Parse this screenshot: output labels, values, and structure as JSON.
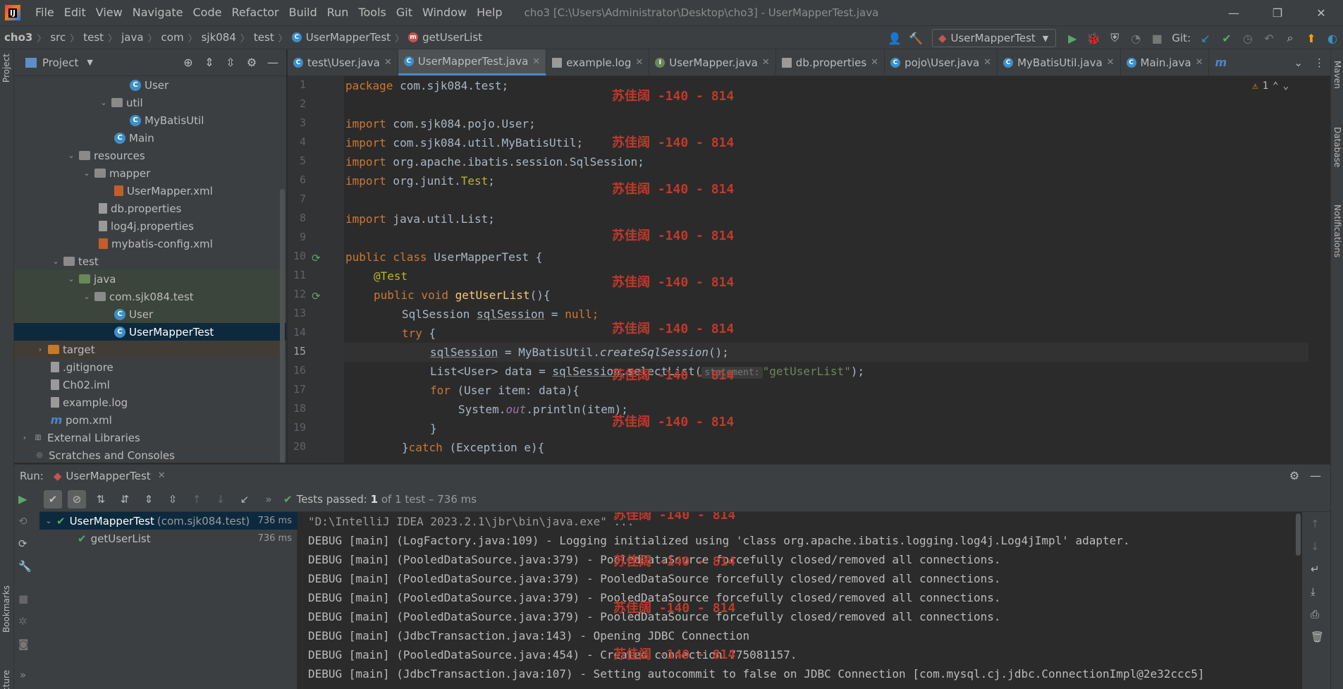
{
  "window": {
    "logo": "IJ",
    "title": "cho3 [C:\\Users\\Administrator\\Desktop\\cho3] - UserMapperTest.java",
    "menu": [
      "File",
      "Edit",
      "View",
      "Navigate",
      "Code",
      "Refactor",
      "Build",
      "Run",
      "Tools",
      "Git",
      "Window",
      "Help"
    ]
  },
  "breadcrumbs": [
    "cho3",
    "src",
    "test",
    "java",
    "com",
    "sjk084",
    "test",
    "UserMapperTest",
    "getUserList"
  ],
  "toolbar": {
    "run_config": "UserMapperTest",
    "git_label": "Git:"
  },
  "project_panel": {
    "title": "Project",
    "tree": [
      {
        "label": "User",
        "icon": "class"
      },
      {
        "label": "util",
        "icon": "folder"
      },
      {
        "label": "MyBatisUtil",
        "icon": "class"
      },
      {
        "label": "Main",
        "icon": "class"
      },
      {
        "label": "resources",
        "icon": "folder"
      },
      {
        "label": "mapper",
        "icon": "folder"
      },
      {
        "label": "UserMapper.xml",
        "icon": "xml"
      },
      {
        "label": "db.properties",
        "icon": "properties"
      },
      {
        "label": "log4j.properties",
        "icon": "properties"
      },
      {
        "label": "mybatis-config.xml",
        "icon": "xml"
      },
      {
        "label": "test",
        "icon": "folder"
      },
      {
        "label": "java",
        "icon": "folder"
      },
      {
        "label": "com.sjk084.test",
        "icon": "package"
      },
      {
        "label": "User",
        "icon": "class"
      },
      {
        "label": "UserMapperTest",
        "icon": "class"
      },
      {
        "label": "target",
        "icon": "folder"
      },
      {
        "label": ".gitignore",
        "icon": "file"
      },
      {
        "label": "Ch02.iml",
        "icon": "file"
      },
      {
        "label": "example.log",
        "icon": "file"
      },
      {
        "label": "pom.xml",
        "icon": "maven"
      },
      {
        "label": "External Libraries",
        "icon": "library"
      },
      {
        "label": "Scratches and Consoles",
        "icon": "scratch"
      }
    ]
  },
  "editor": {
    "tabs": [
      "test\\User.java",
      "UserMapperTest.java",
      "example.log",
      "UserMapper.java",
      "db.properties",
      "pojo\\User.java",
      "MyBatisUtil.java",
      "Main.java"
    ],
    "active_tab": "UserMapperTest.java",
    "warning_count": "1",
    "line_numbers": [
      "1",
      "2",
      "3",
      "4",
      "5",
      "6",
      "7",
      "8",
      "9",
      "10",
      "11",
      "12",
      "13",
      "14",
      "15",
      "16",
      "17",
      "18",
      "19",
      "20"
    ],
    "current_line": "15",
    "code": {
      "l1_kw": "package",
      "l1_rest": " com.sjk084.test;",
      "l3_kw": "import",
      "l3_rest": " com.sjk084.pojo.User;",
      "l4_kw": "import",
      "l4_rest": " com.sjk084.util.MyBatisUtil;",
      "l5_kw": "import",
      "l5_rest": " org.apache.ibatis.session.SqlSession;",
      "l6_kw": "import",
      "l6_rest": " org.junit.",
      "l6_ann": "Test",
      "l6_end": ";",
      "l8_kw": "import",
      "l8_rest": " java.util.List;",
      "l10_kw": "public class",
      "l10_rest": " UserMapperTest {",
      "l11_ann": "@Test",
      "l12_kw": "public void",
      "l12_fn": "getUserList",
      "l12_rest": "(){",
      "l13_a": "SqlSession ",
      "l13_var": "sqlSession",
      "l13_b": " = ",
      "l13_kw": "null",
      "l13_end": ";",
      "l14_kw": "try",
      "l14_rest": " {",
      "l15_var": "sqlSession",
      "l15_a": " = MyBatisUtil.",
      "l15_m": "createSqlSession",
      "l15_end": "();",
      "l16_a": "List<User> data = ",
      "l16_var": "sqlSession",
      "l16_b": ".selectList(",
      "l16_hint": "statement:",
      "l16_str": "\"getUserList\"",
      "l16_end": ");",
      "l17_kw": "for",
      "l17_rest": " (User item: data){",
      "l18_a": "System.",
      "l18_fld": "out",
      "l18_rest": ".println(item);",
      "l19": "}",
      "l20_a": "}",
      "l20_kw": "catch",
      "l20_rest": " (Exception e){"
    }
  },
  "watermark": "苏佳阔 -140 - 814",
  "run_panel": {
    "label": "Run:",
    "tab": "UserMapperTest",
    "status_prefix": "Tests passed:",
    "status_count": "1",
    "status_suffix": "of 1 test – 736 ms",
    "tests": [
      {
        "name": "UserMapperTest",
        "pkg": "(com.sjk084.test)",
        "time": "736 ms"
      },
      {
        "name": "getUserList",
        "pkg": "",
        "time": "736 ms"
      }
    ],
    "console": [
      "\"D:\\IntelliJ IDEA 2023.2.1\\jbr\\bin\\java.exe\" ...",
      "DEBUG [main] (LogFactory.java:109) - Logging initialized using 'class org.apache.ibatis.logging.log4j.Log4jImpl' adapter.",
      "DEBUG [main] (PooledDataSource.java:379) - PooledDataSource forcefully closed/removed all connections.",
      "DEBUG [main] (PooledDataSource.java:379) - PooledDataSource forcefully closed/removed all connections.",
      "DEBUG [main] (PooledDataSource.java:379) - PooledDataSource forcefully closed/removed all connections.",
      "DEBUG [main] (PooledDataSource.java:379) - PooledDataSource forcefully closed/removed all connections.",
      "DEBUG [main] (JdbcTransaction.java:143) - Opening JDBC Connection",
      "DEBUG [main] (PooledDataSource.java:454) - Created connection 775081157.",
      "DEBUG [main] (JdbcTransaction.java:107) - Setting autocommit to false on JDBC Connection [com.mysql.cj.jdbc.ConnectionImpl@2e32ccc5]"
    ]
  },
  "side_labels": {
    "left_top": "Project",
    "left_bookmarks": "Bookmarks",
    "left_structure": "Structure",
    "right_maven": "Maven",
    "right_database": "Database",
    "right_notifications": "Notifications"
  }
}
